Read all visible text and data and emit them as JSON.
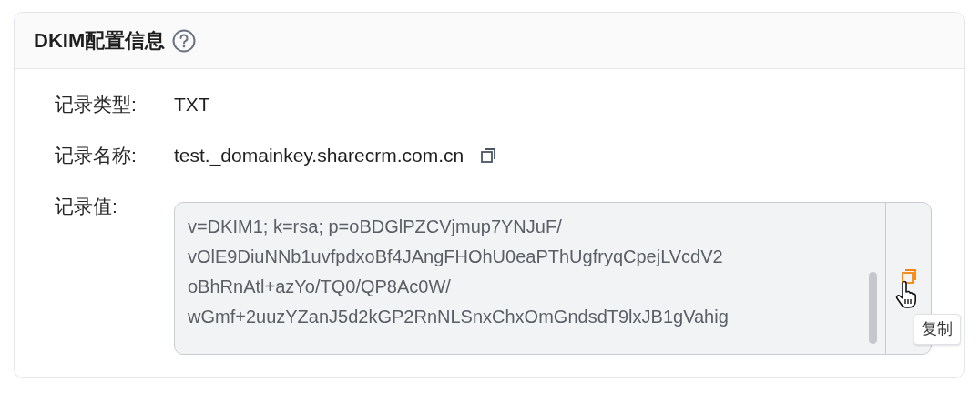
{
  "card": {
    "title": "DKIM配置信息"
  },
  "fields": [
    {
      "label": "记录类型:",
      "value": "TXT",
      "kind": "text"
    },
    {
      "label": "记录名称:",
      "value": "test._domainkey.sharecrm.com.cn",
      "kind": "copyable"
    },
    {
      "label": "记录值:",
      "kind": "box",
      "value_lines": [
        "v=DKIM1; k=rsa; p=oBDGlPZCVjmup7YNJuF/",
        "vOlE9DiuNNb1uvfpdxoBf4JAngFHOhU0eaPThUgfryqCpejLVcdV2",
        "oBhRnAtl+azYo/TQ0/QP8Ac0W/",
        "wGmf+2uuzYZanJ5d2kGP2RnNLSnxChxOmGndsdT9lxJB1gVahig"
      ]
    }
  ],
  "tooltip": "复制"
}
